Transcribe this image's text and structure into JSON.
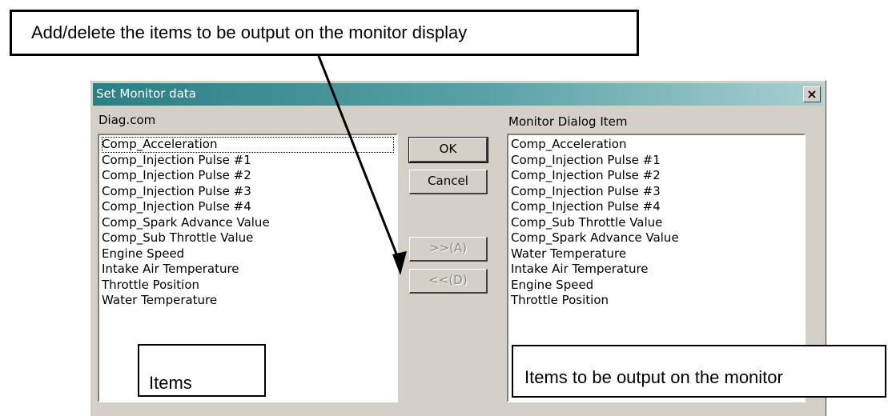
{
  "callouts": {
    "top": "Add/delete the items to be output on the monitor display",
    "items": "Items",
    "output": "Items to be output on the monitor"
  },
  "dialog": {
    "title": "Set Monitor data",
    "close_glyph": "×",
    "left_label": "Diag.com",
    "right_label": "Monitor Dialog Item",
    "buttons": {
      "ok": "OK",
      "cancel": "Cancel",
      "add": ">>(A)",
      "delete": "<<(D)"
    },
    "left_items": [
      "Comp_Acceleration",
      "Comp_Injection Pulse #1",
      "Comp_Injection Pulse #2",
      "Comp_Injection Pulse #3",
      "Comp_Injection Pulse #4",
      "Comp_Spark Advance Value",
      "Comp_Sub Throttle Value",
      "Engine Speed",
      "Intake Air Temperature",
      "Throttle Position",
      "Water Temperature"
    ],
    "right_items": [
      "Comp_Acceleration",
      "Comp_Injection Pulse #1",
      "Comp_Injection Pulse #2",
      "Comp_Injection Pulse #3",
      "Comp_Injection Pulse #4",
      "Comp_Sub Throttle Value",
      "Comp_Spark Advance Value",
      "Water Temperature",
      "Intake Air Temperature",
      "Engine Speed",
      "Throttle Position"
    ]
  }
}
